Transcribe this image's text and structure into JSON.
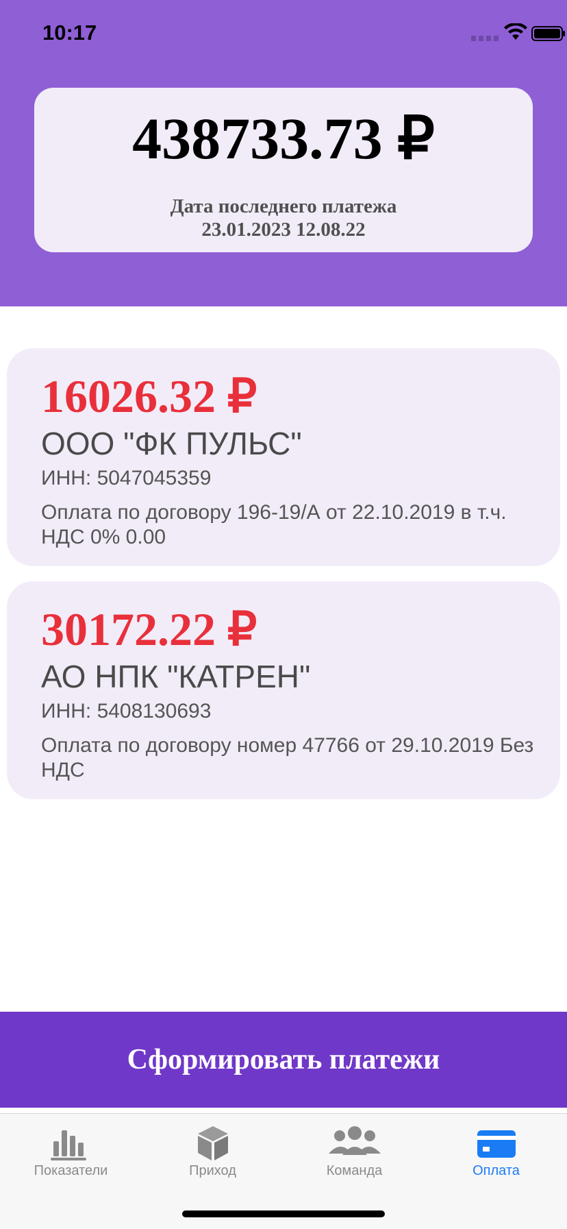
{
  "status_bar": {
    "time": "10:17",
    "icons": [
      "signal-icon",
      "wifi-icon",
      "battery-icon"
    ]
  },
  "balance": {
    "amount": "438733.73 ₽",
    "last_payment_label": "Дата последнего платежа",
    "last_payment_date": "23.01.2023 12.08.22"
  },
  "payments": [
    {
      "amount": "16026.32 ₽",
      "company": "ООО \"ФК ПУЛЬС\"",
      "inn": "ИНН: 5047045359",
      "purpose": "Оплата по договору 196-19/А от 22.10.2019 в т.ч. НДС 0% 0.00"
    },
    {
      "amount": "30172.22 ₽",
      "company": "АО НПК \"КАТРЕН\"",
      "inn": "ИНН: 5408130693",
      "purpose": "Оплата по договору номер 47766 от 29.10.2019 Без НДС"
    }
  ],
  "action": {
    "label": "Сформировать платежи"
  },
  "tabs": [
    {
      "label": "Показатели",
      "icon": "bar-chart-icon",
      "active": false
    },
    {
      "label": "Приход",
      "icon": "box-icon",
      "active": false
    },
    {
      "label": "Команда",
      "icon": "team-icon",
      "active": false
    },
    {
      "label": "Оплата",
      "icon": "card-icon",
      "active": true
    }
  ],
  "colors": {
    "header": "#8f5fd6",
    "card": "#f2ecf8",
    "amount_red": "#e8303b",
    "button": "#7038c8",
    "tab_active": "#1a7cf5",
    "tab_inactive": "#8a8a8a"
  }
}
